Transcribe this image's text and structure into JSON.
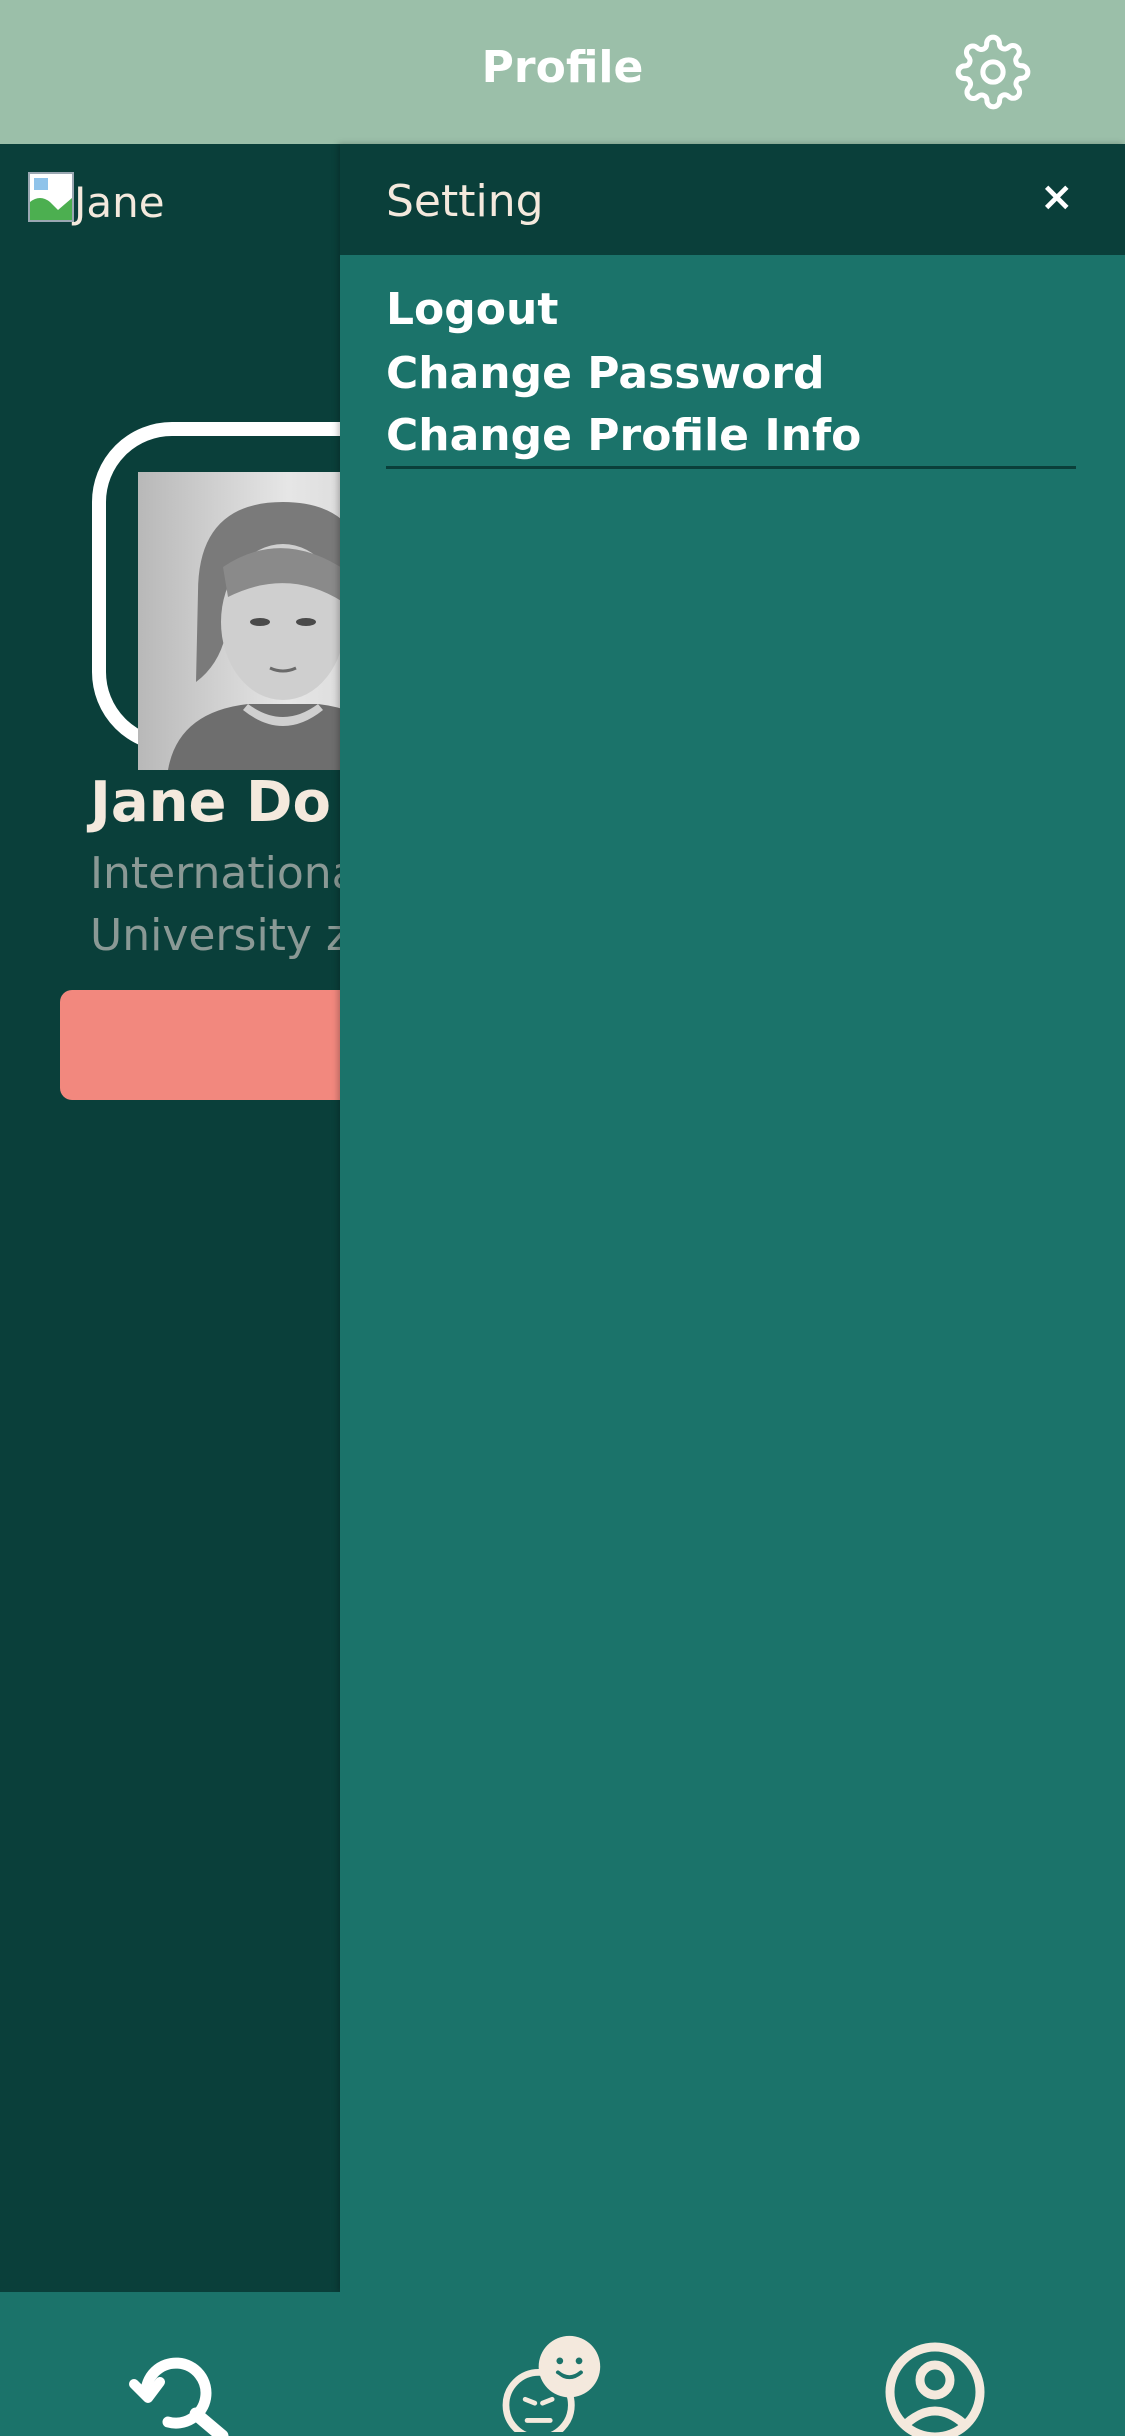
{
  "header": {
    "title": "Profile",
    "settings_icon": "gear-icon"
  },
  "profile": {
    "broken_image_alt": "Jane",
    "name": "Jane Do",
    "subtitle_line1": "Internationa",
    "subtitle_line2": "University zv"
  },
  "drawer": {
    "title": "Setting",
    "close_label": "×",
    "items": [
      {
        "label": "Logout"
      },
      {
        "label": "Change Password"
      },
      {
        "label": "Change Profile Info"
      }
    ]
  },
  "bottom_nav": {
    "items": [
      {
        "icon": "search-refresh-icon"
      },
      {
        "icon": "chat-faces-icon"
      },
      {
        "icon": "user-profile-icon"
      }
    ]
  },
  "colors": {
    "header_bg": "#9bbfa9",
    "page_bg": "#0a3f3a",
    "drawer_bg": "#1b736a",
    "accent_button": "#f2887e",
    "cream_text": "#f4e9dd"
  }
}
